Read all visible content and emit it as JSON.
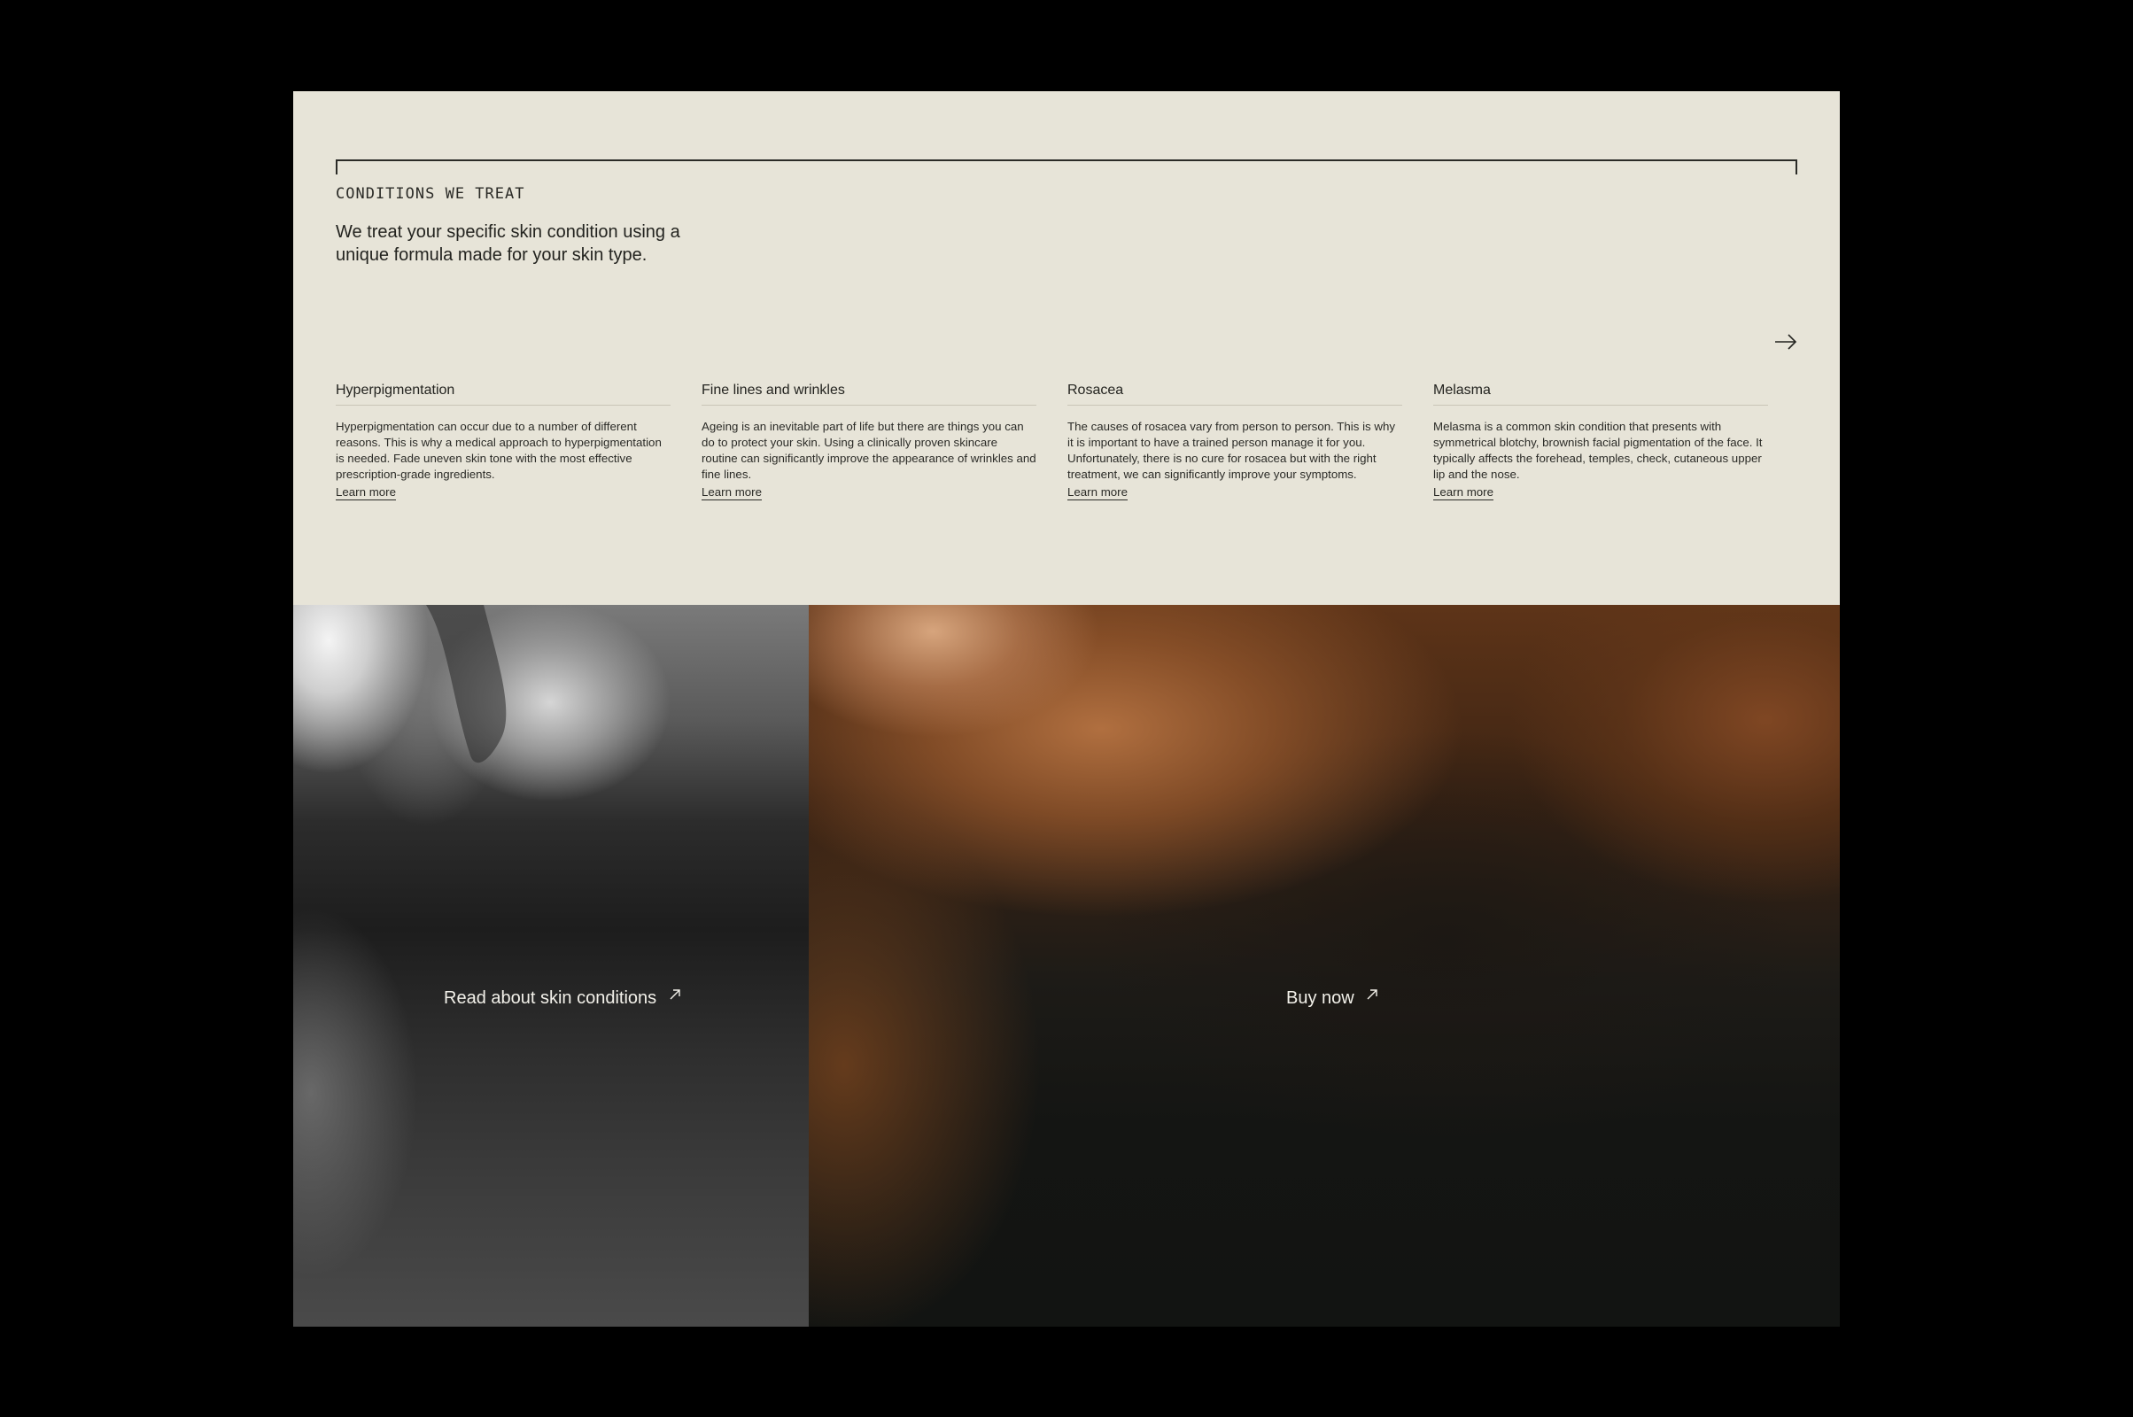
{
  "section": {
    "eyebrow": "CONDITIONS WE TREAT",
    "lede": "We treat your specific skin condition using a unique formula made for your skin type.",
    "next_icon": "arrow-right-icon"
  },
  "conditions": [
    {
      "title": "Hyperpigmentation",
      "body": "Hyperpigmentation can occur due to a number of different reasons. This is why a medical approach to hyperpigmentation is needed. Fade uneven skin tone with the most effective prescription-grade ingredients.",
      "link": "Learn more"
    },
    {
      "title": "Fine lines and wrinkles",
      "body": "Ageing is an inevitable part of life but there are things you can do to protect your skin. Using a clinically proven skincare routine can significantly improve the appearance of wrinkles and fine lines.",
      "link": "Learn more"
    },
    {
      "title": "Rosacea",
      "body": "The causes of rosacea vary from person to person. This is why it is important to have a trained person manage it for you. Unfortunately, there is no cure for rosacea but with the right treatment, we can significantly improve your symptoms.",
      "link": "Learn more"
    },
    {
      "title": "Melasma",
      "body": "Melasma is a common skin condition that presents with symmetrical blotchy, brownish facial pigmentation of the face. It typically affects the forehead, temples, check, cutaneous upper lip and the nose.",
      "link": "Learn more"
    }
  ],
  "panels": {
    "left": {
      "cta": "Read about skin conditions",
      "icon": "arrow-up-right-icon"
    },
    "right": {
      "cta": "Buy now",
      "icon": "arrow-up-right-icon"
    }
  },
  "colors": {
    "background": "#000000",
    "cream": "#e7e4d8",
    "ink": "#23231f",
    "cta_text": "#f3f1ea"
  }
}
